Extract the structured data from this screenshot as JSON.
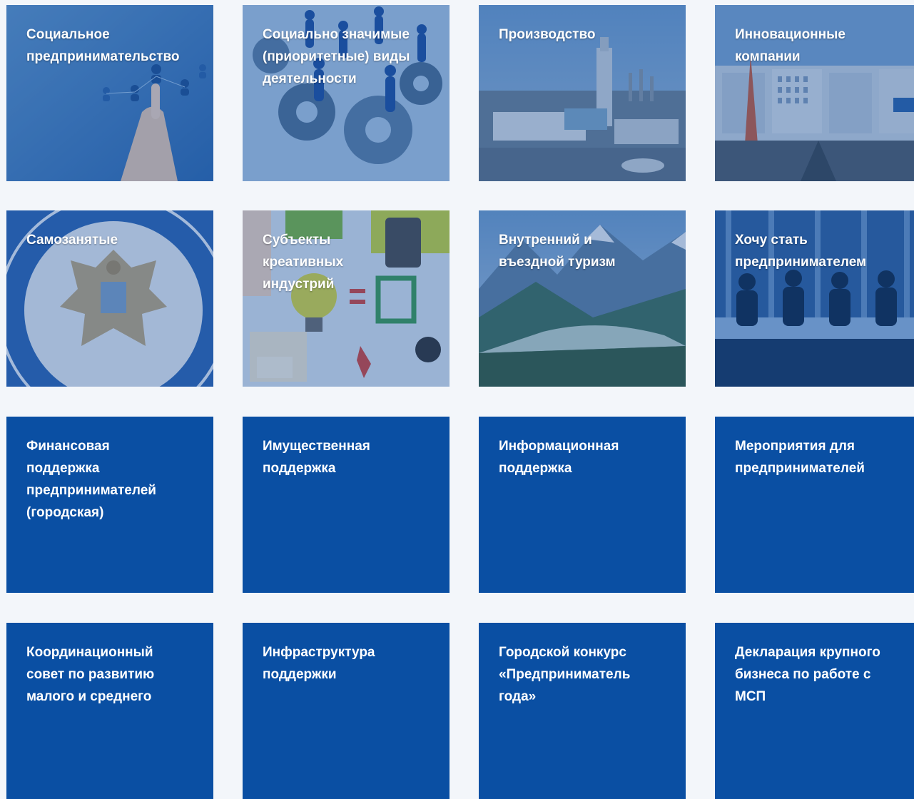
{
  "colors": {
    "page_background": "#f3f6fa",
    "tile_blue": "#0a4fa3",
    "label_text": "#ffffff"
  },
  "tiles": [
    {
      "label": "Социальное\nпредпринимательство",
      "icon": "hand-touch-people-network-icon"
    },
    {
      "label": "Социально значимые\n(приоритетные) виды\nдеятельности",
      "icon": "people-on-gears-icon"
    },
    {
      "label": "Производство",
      "icon": "industrial-plant-icon"
    },
    {
      "label": "Инновационные\nкомпании",
      "icon": "city-road-buildings-icon"
    },
    {
      "label": "Самозанятые",
      "icon": "tax-service-emblem-icon"
    },
    {
      "label": "Субъекты\nкреативных\nиндустрий",
      "icon": "creative-desk-lightbulb-icon"
    },
    {
      "label": "Внутренний и\nвъездной туризм",
      "icon": "mountain-valley-icon"
    },
    {
      "label": "Хочу стать\nпредпринимателем",
      "icon": "meeting-room-silhouettes-icon"
    },
    {
      "label": "Финансовая\nподдержка\nпредпринимателей\n(городская)"
    },
    {
      "label": "Имущественная\nподдержка"
    },
    {
      "label": "Информационная\nподдержка"
    },
    {
      "label": "Мероприятия для\nпредпринимателей"
    },
    {
      "label": "Координационный\nсовет по развитию\nмалого и среднего"
    },
    {
      "label": "Инфраструктура\nподдержки"
    },
    {
      "label": "Городской конкурс\n«Предприниматель\nгода»"
    },
    {
      "label": "Декларация крупного\nбизнеса по работе с\nМСП"
    }
  ]
}
